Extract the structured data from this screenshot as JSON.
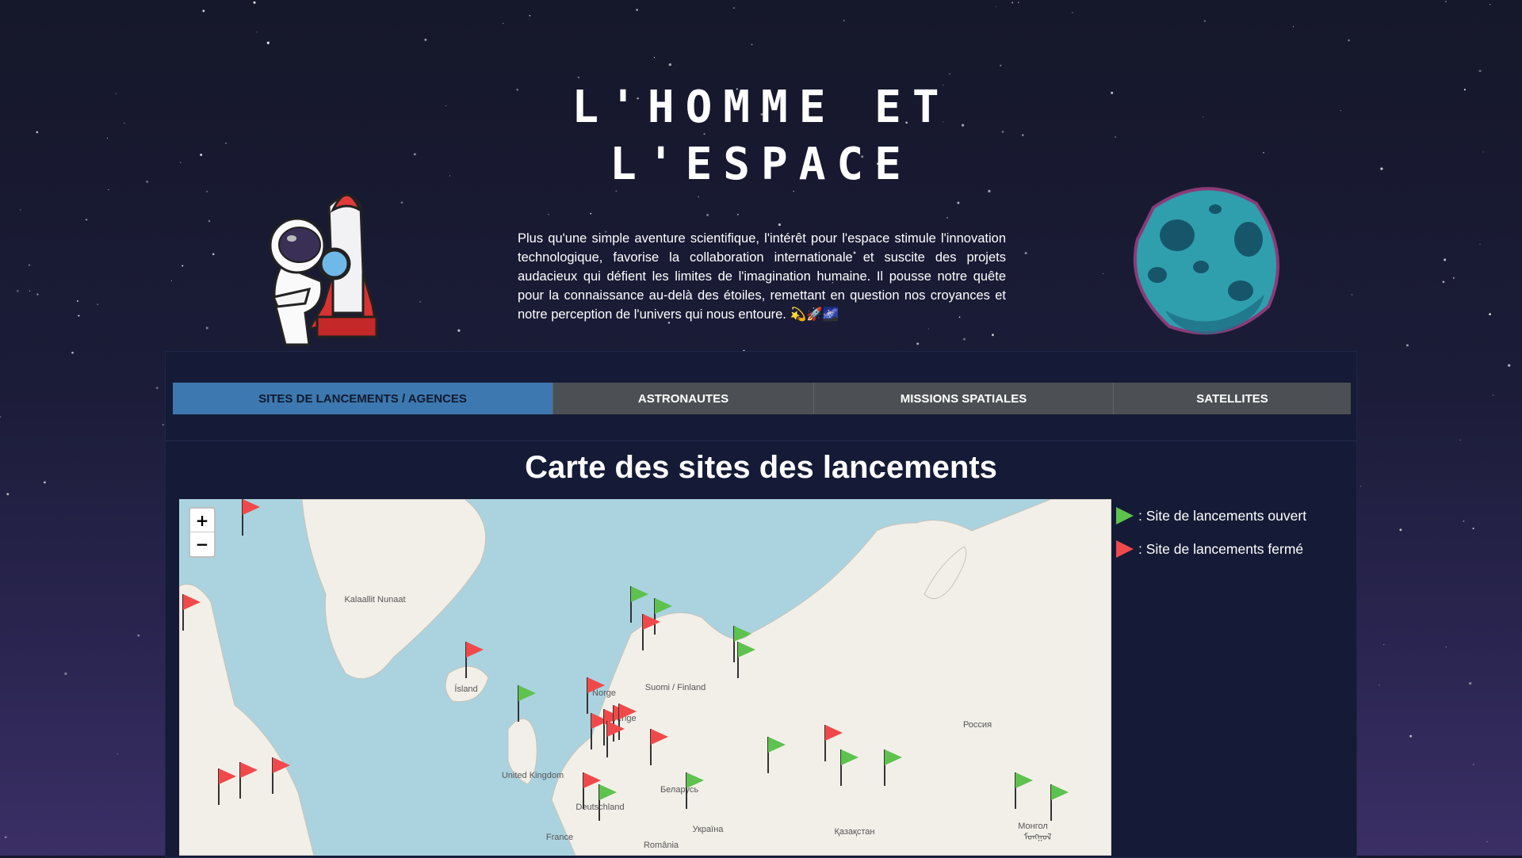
{
  "header": {
    "title_line1": "L'HOMME ET",
    "title_line2": "L'ESPACE",
    "intro": "Plus qu'une simple aventure scientifique, l'intérêt pour l'espace stimule l'innovation technologique, favorise la collaboration internationale et suscite des projets audacieux qui défient les limites de l'imagination humaine. Il pousse notre quête pour la connaissance au-delà des étoiles, remettant en question nos croyances et notre perception de l'univers qui nous entoure. 💫🚀🌌"
  },
  "tabs": [
    {
      "label": "SITES DE LANCEMENTS / AGENCES",
      "active": true
    },
    {
      "label": "ASTRONAUTES",
      "active": false
    },
    {
      "label": "MISSIONS SPATIALES",
      "active": false
    },
    {
      "label": "SATELLITES",
      "active": false
    }
  ],
  "map_section": {
    "title": "Carte des sites des lancements",
    "zoom_in": "+",
    "zoom_out": "−",
    "place_labels": [
      "Kalaallit Nunaat",
      "Ísland",
      "Norge",
      "Sverige",
      "Suomi / Finland",
      "United Kingdom",
      "Deutschland",
      "France",
      "Беларусь",
      "Україна",
      "România",
      "Россия",
      "Қазақстан",
      "Монгол",
      "ᠮᠣᠩᠭᠣᠯ"
    ]
  },
  "legend": {
    "open_label": ": Site de lancements ouvert",
    "closed_label": ": Site de lancements fermé"
  },
  "colors": {
    "open_flag": "#5ec24e",
    "closed_flag": "#f0494b",
    "active_tab": "#3d78b0",
    "tab_bar": "#4c5054",
    "water": "#aad3df",
    "land": "#f2efe9"
  }
}
